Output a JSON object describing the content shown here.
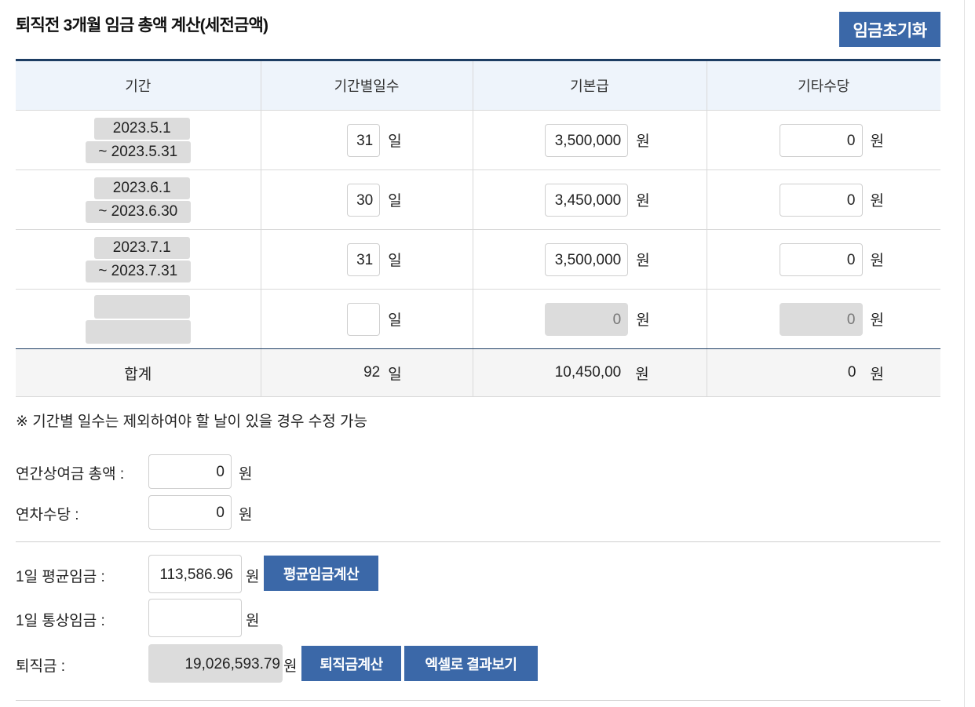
{
  "page": {
    "title": "퇴직전 3개월 임금 총액 계산(세전금액)",
    "reset_button": "임금초기화"
  },
  "table": {
    "headers": [
      "기간",
      "기간별일수",
      "기본급",
      "기타수당"
    ],
    "rows": [
      {
        "start": "2023.5.1",
        "end": "~ 2023.5.31",
        "days": "31",
        "base": "3,500,000",
        "other": "0"
      },
      {
        "start": "2023.6.1",
        "end": "~ 2023.6.30",
        "days": "30",
        "base": "3,450,000",
        "other": "0"
      },
      {
        "start": "2023.7.1",
        "end": "~ 2023.7.31",
        "days": "31",
        "base": "3,500,000",
        "other": "0"
      },
      {
        "start": "",
        "end": "",
        "days": "",
        "base": "0",
        "other": "0"
      }
    ],
    "day_unit": "일",
    "won_unit": "원",
    "sum": {
      "label": "합계",
      "days": "92",
      "base": "10,450,00",
      "other": "0"
    }
  },
  "note": "※ 기간별 일수는 제외하여야 할 날이 있을 경우 수정 가능",
  "bonus": {
    "label": "연간상여금 총액 :",
    "value": "0",
    "unit": "원"
  },
  "annual_allowance": {
    "label": "연차수당 :",
    "value": "0",
    "unit": "원"
  },
  "avg_wage": {
    "label": "1일 평균임금 :",
    "value": "113,586.96",
    "unit": "원",
    "button": "평균임금계산"
  },
  "ordinary_wage": {
    "label": "1일 통상임금 :",
    "value": "",
    "unit": "원"
  },
  "severance": {
    "label": "퇴직금 :",
    "value": "19,026,593.79",
    "unit": "원",
    "calc_button": "퇴직금계산",
    "excel_button": "엑셀로 결과보기"
  }
}
